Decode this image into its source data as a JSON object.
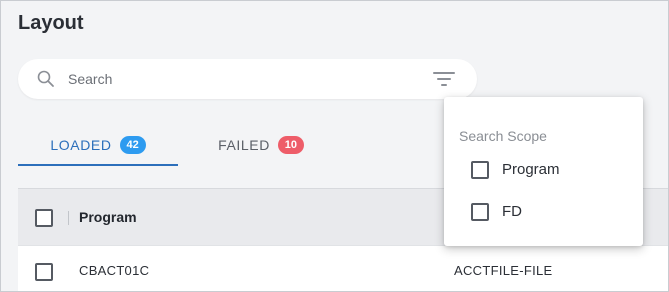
{
  "page": {
    "title": "Layout"
  },
  "search": {
    "placeholder": "Search",
    "value": "",
    "icon": "search-icon",
    "filter_icon": "filter-icon"
  },
  "tabs": [
    {
      "label": "LOADED",
      "count": "42",
      "active": true,
      "badge_color": "#2d9bf0"
    },
    {
      "label": "FAILED",
      "count": "10",
      "active": false,
      "badge_color": "#ee5d69"
    }
  ],
  "table": {
    "columns": [
      "Program"
    ],
    "rows": [
      {
        "program": "CBACT01C",
        "fd": "ACCTFILE-FILE",
        "checked": false
      }
    ]
  },
  "search_scope": {
    "title": "Search Scope",
    "options": [
      {
        "label": "Program",
        "checked": false
      },
      {
        "label": "FD",
        "checked": false
      }
    ]
  },
  "colors": {
    "accent": "#2c6fbb",
    "background": "#f3f4f6"
  }
}
